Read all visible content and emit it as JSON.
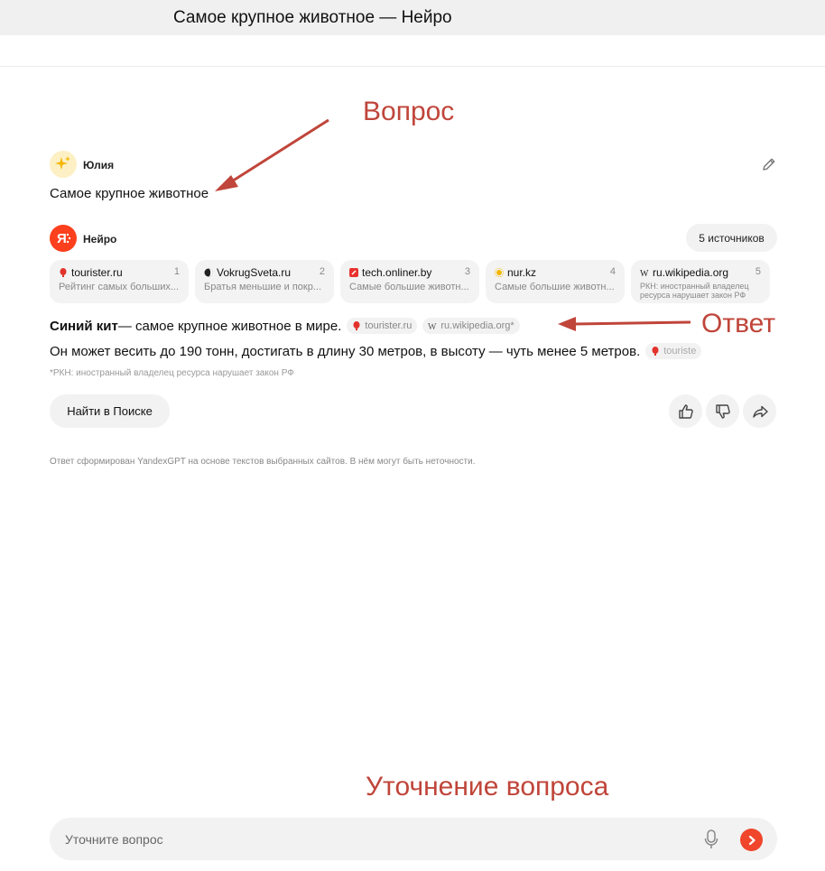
{
  "window": {
    "title": "Самое крупное животное — Нейро"
  },
  "annotations": {
    "question": "Вопрос",
    "answer": "Ответ",
    "refine": "Уточнение вопроса"
  },
  "question": {
    "user_name": "Юлия",
    "text": "Самое крупное животное"
  },
  "assistant": {
    "name": "Нейро",
    "sources_button": "5 источников"
  },
  "sources": [
    {
      "domain": "tourister.ru",
      "num": "1",
      "desc": "Рейтинг самых больших...",
      "icon": "balloon-icon"
    },
    {
      "domain": "VokrugSveta.ru",
      "num": "2",
      "desc": "Братья меньшие и покр...",
      "icon": "globe-icon"
    },
    {
      "domain": "tech.onliner.by",
      "num": "3",
      "desc": "Самые большие животн...",
      "icon": "onliner-icon"
    },
    {
      "domain": "nur.kz",
      "num": "4",
      "desc": "Самые большие животн...",
      "icon": "sun-icon"
    },
    {
      "domain": "ru.wikipedia.org",
      "num": "5",
      "desc": "РКН: иностранный владелец ресурса нарушает закон РФ",
      "icon": "wikipedia-icon"
    }
  ],
  "answer": {
    "bold": "Синий кит",
    "line1_rest": " — самое крупное животное в мире.",
    "chip1": "tourister.ru",
    "chip2": "ru.wikipedia.org*",
    "line2": "Он может весить до 190 тонн, достигать в длину 30 метров, в высоту — чуть менее 5 метров.",
    "chip3": "touriste",
    "rkn_note": "*РКН: иностранный владелец ресурса нарушает закон РФ"
  },
  "actions": {
    "find_button": "Найти в Поиске"
  },
  "disclaimer": "Ответ сформирован YandexGPT на основе текстов выбранных сайтов. В нём могут быть неточности.",
  "input": {
    "placeholder": "Уточните вопрос",
    "value": ""
  },
  "colors": {
    "annotation": "#c0453a",
    "brand_red": "#fc3f1d",
    "send_button": "#f0462c"
  }
}
